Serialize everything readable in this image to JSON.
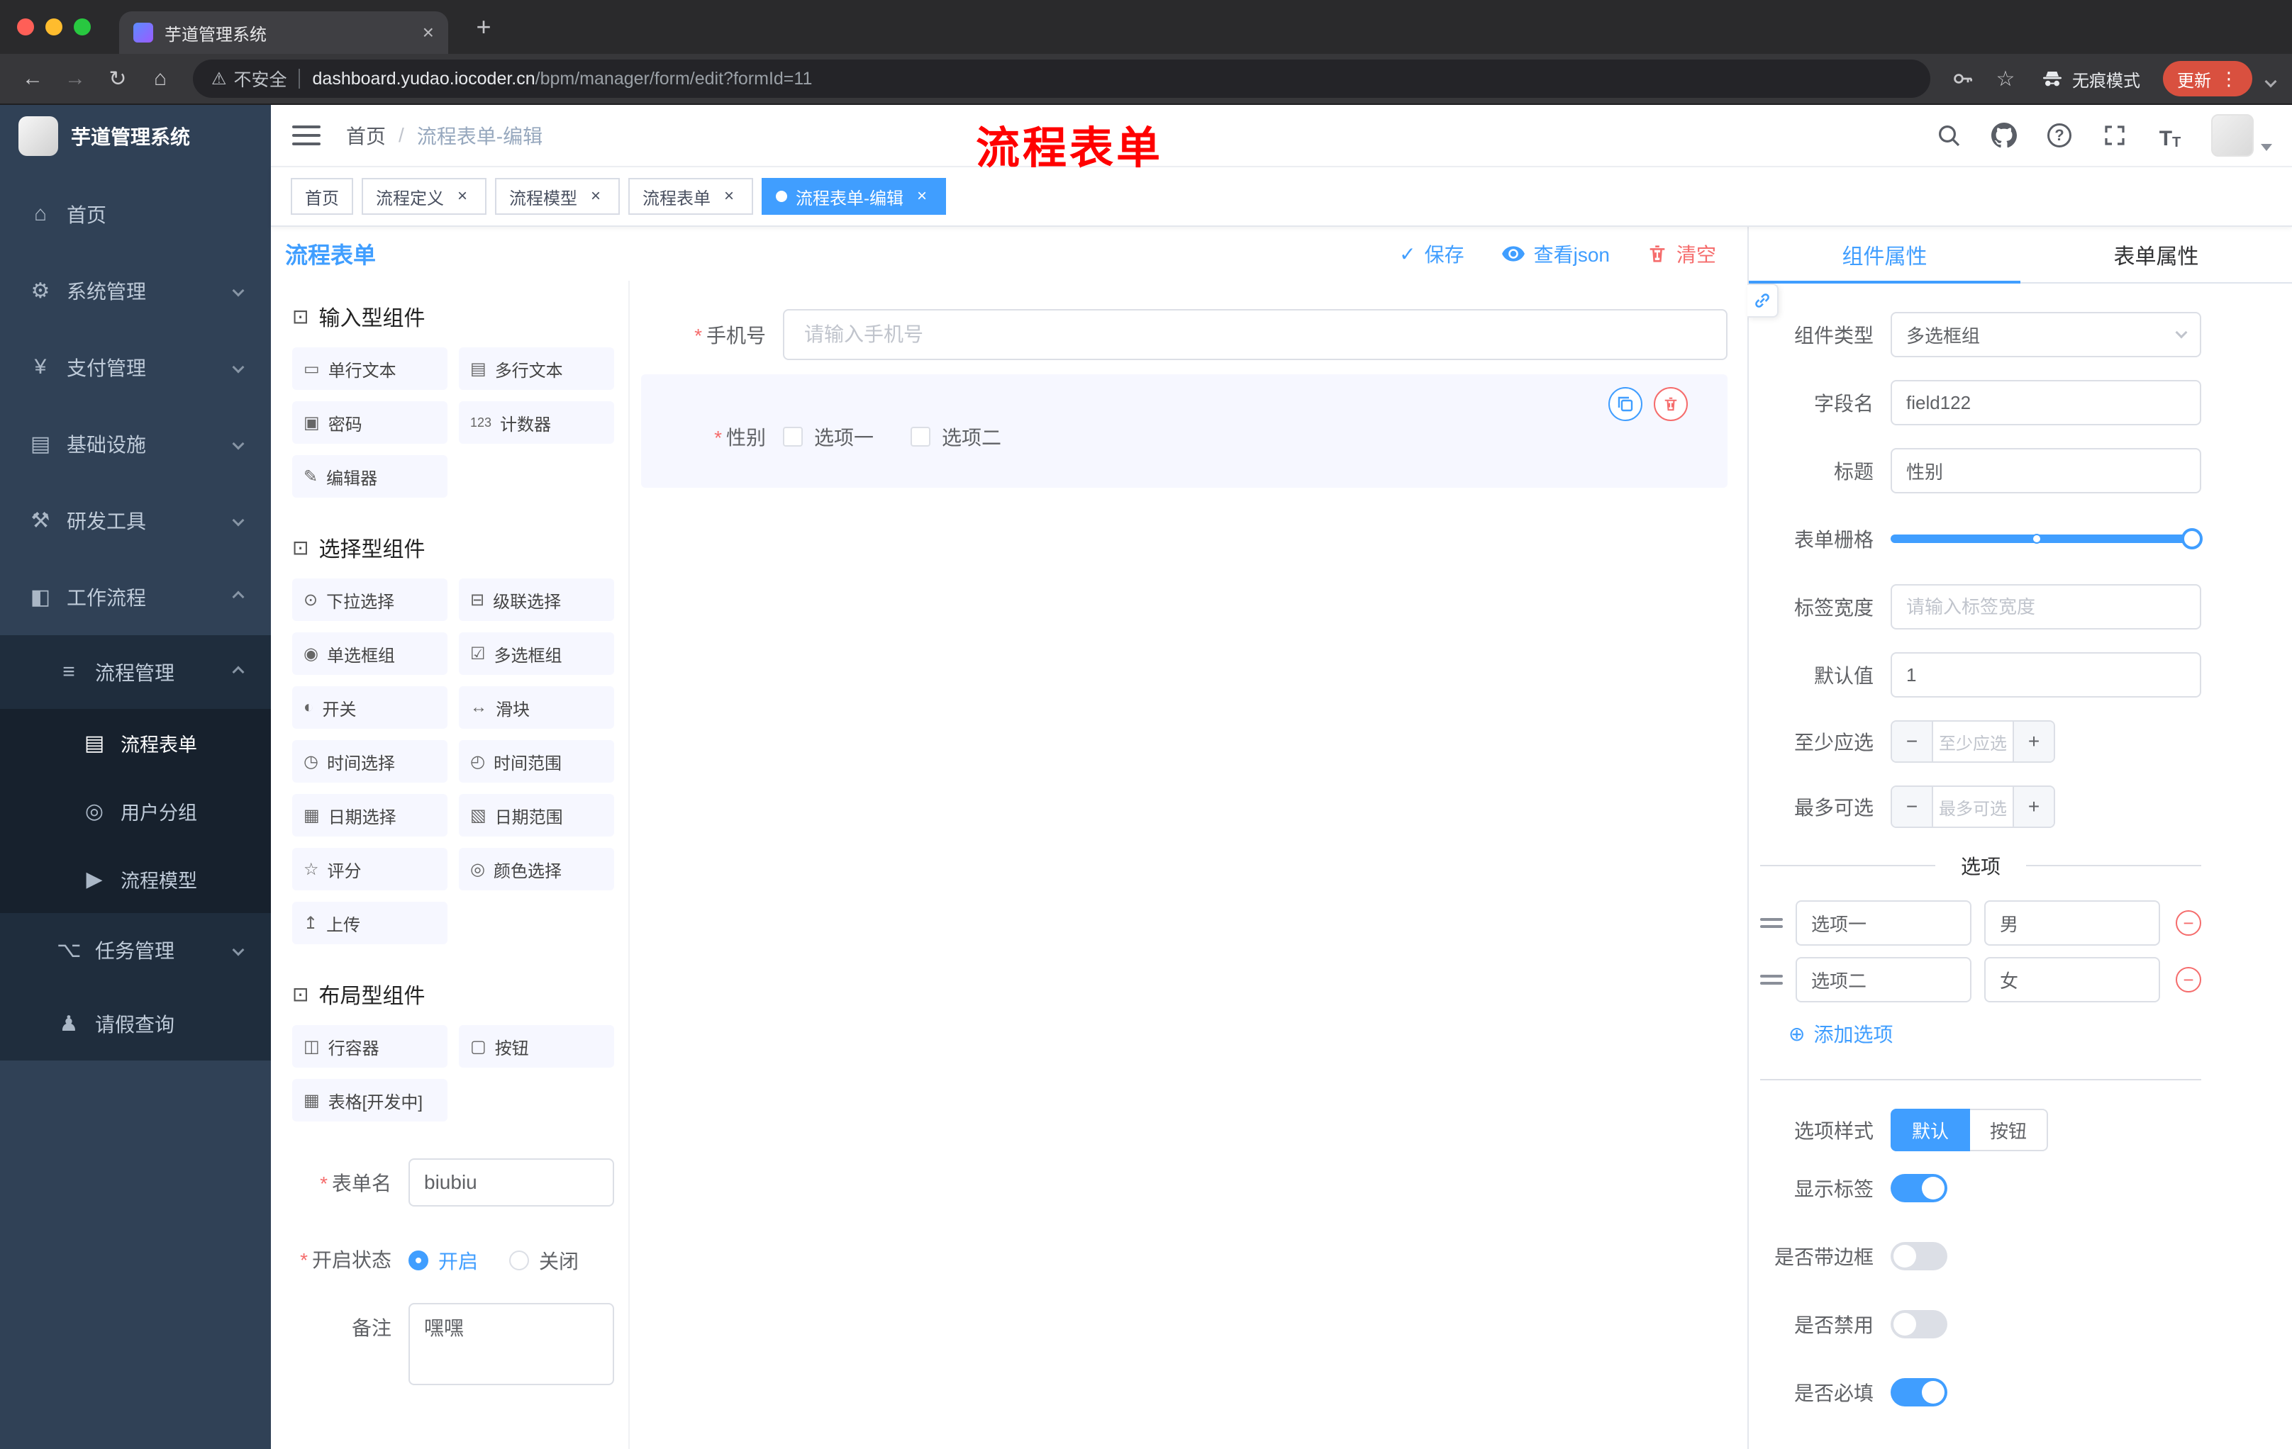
{
  "annotation": {
    "text": "流程表单",
    "color": "#ff0000"
  },
  "glyphs": {
    "close": "×",
    "plus": "+",
    "back": "←",
    "forward": "→",
    "reload": "↻",
    "home": "⌂",
    "star": "☆",
    "dots": "⋮",
    "warning": "⚠",
    "check": "✓",
    "minus": "−",
    "add": "⊕",
    "asterisk": "*",
    "question": "?",
    "font_large": "T",
    "font_small": "T"
  },
  "browser": {
    "tab_title": "芋道管理系统",
    "security_label": "不安全",
    "url_host": "dashboard.yudao.iocoder.cn",
    "url_path": "/bpm/manager/form/edit?formId=11",
    "incognito_label": "无痕模式",
    "update_label": "更新",
    "update_color": "#d9503f"
  },
  "sidebar": {
    "logo_title": "芋道管理系统",
    "items": [
      {
        "label": "首页",
        "icon": "⌂"
      },
      {
        "label": "系统管理",
        "icon": "⚙"
      },
      {
        "label": "支付管理",
        "icon": "¥"
      },
      {
        "label": "基础设施",
        "icon": "▤"
      },
      {
        "label": "研发工具",
        "icon": "⚒"
      },
      {
        "label": "工作流程",
        "icon": "◧"
      },
      {
        "label": "流程管理",
        "icon": "≡"
      },
      {
        "label": "流程表单",
        "icon": "▤"
      },
      {
        "label": "用户分组",
        "icon": "◎"
      },
      {
        "label": "流程模型",
        "icon": "▶"
      },
      {
        "label": "任务管理",
        "icon": "⌥"
      },
      {
        "label": "请假查询",
        "icon": "♟"
      }
    ]
  },
  "navbar": {
    "breadcrumb_root": "首页",
    "breadcrumb_sep": "/",
    "breadcrumb_current": "流程表单-编辑"
  },
  "tags": [
    {
      "label": "首页"
    },
    {
      "label": "流程定义"
    },
    {
      "label": "流程模型"
    },
    {
      "label": "流程表单"
    },
    {
      "label": "流程表单-编辑"
    }
  ],
  "designer": {
    "title": "流程表单",
    "toolbar": {
      "save": "保存",
      "view_json": "查看json",
      "clear": "清空"
    },
    "palette": {
      "sections": [
        {
          "title": "输入型组件",
          "icon": "⊡",
          "items": [
            {
              "label": "单行文本",
              "icon": "▭"
            },
            {
              "label": "多行文本",
              "icon": "▤"
            },
            {
              "label": "密码",
              "icon": "▣"
            },
            {
              "label": "计数器",
              "icon": "123"
            },
            {
              "label": "编辑器",
              "icon": "✎"
            }
          ]
        },
        {
          "title": "选择型组件",
          "icon": "⊡",
          "items": [
            {
              "label": "下拉选择",
              "icon": "⊙"
            },
            {
              "label": "级联选择",
              "icon": "⊟"
            },
            {
              "label": "单选框组",
              "icon": "◉"
            },
            {
              "label": "多选框组",
              "icon": "☑"
            },
            {
              "label": "开关",
              "icon": "◐"
            },
            {
              "label": "滑块",
              "icon": "↔"
            },
            {
              "label": "时间选择",
              "icon": "◷"
            },
            {
              "label": "时间范围",
              "icon": "◴"
            },
            {
              "label": "日期选择",
              "icon": "▦"
            },
            {
              "label": "日期范围",
              "icon": "▧"
            },
            {
              "label": "评分",
              "icon": "☆"
            },
            {
              "label": "颜色选择",
              "icon": "◎"
            },
            {
              "label": "上传",
              "icon": "↥"
            }
          ]
        },
        {
          "title": "布局型组件",
          "icon": "⊡",
          "items": [
            {
              "label": "行容器",
              "icon": "◫"
            },
            {
              "label": "按钮",
              "icon": "▢"
            },
            {
              "label": "表格[开发中]",
              "icon": "▦"
            }
          ]
        }
      ]
    },
    "meta": {
      "name_label": "表单名",
      "name_value": "biubiu",
      "status_label": "开启状态",
      "status_on": "开启",
      "status_off": "关闭",
      "remark_label": "备注",
      "remark_value": "嘿嘿"
    },
    "canvas": {
      "phone_label": "手机号",
      "phone_placeholder": "请输入手机号",
      "gender_label": "性别",
      "gender_option1": "选项一",
      "gender_option2": "选项二"
    }
  },
  "props": {
    "accent": "#409EFF",
    "danger": "#F56C6C",
    "tab_component": "组件属性",
    "tab_form": "表单属性",
    "component_type_label": "组件类型",
    "component_type_value": "多选框组",
    "field_name_label": "字段名",
    "field_name_value": "field122",
    "title_label": "标题",
    "title_value": "性别",
    "grid_label": "表单栅格",
    "label_width_label": "标签宽度",
    "label_width_placeholder": "请输入标签宽度",
    "default_label": "默认值",
    "default_value": "1",
    "min_label": "至少应选",
    "min_placeholder": "至少应选",
    "max_label": "最多可选",
    "max_placeholder": "最多可选",
    "options_divider": "选项",
    "options": [
      {
        "label_value": "选项一",
        "value_value": "男"
      },
      {
        "label_value": "选项二",
        "value_value": "女"
      }
    ],
    "add_option": "添加选项",
    "style_label": "选项样式",
    "style_default": "默认",
    "style_button": "按钮",
    "switch_show_label": "显示标签",
    "switch_border": "是否带边框",
    "switch_disabled": "是否禁用",
    "switch_required": "是否必填"
  }
}
